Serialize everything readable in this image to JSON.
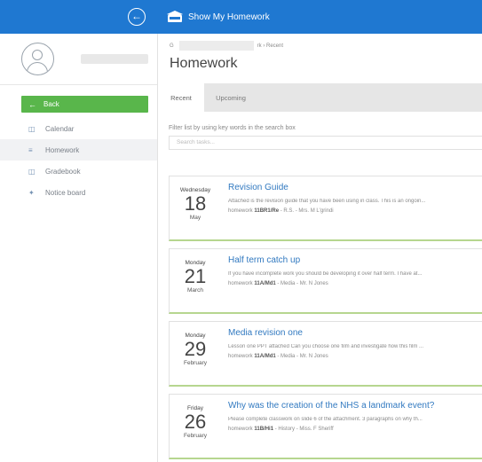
{
  "app": {
    "title": "Show My Homework"
  },
  "sidebar": {
    "back_label": "Back",
    "items": [
      {
        "label": "Calendar",
        "icon": "calendar-icon"
      },
      {
        "label": "Homework",
        "icon": "list-icon"
      },
      {
        "label": "Gradebook",
        "icon": "book-icon"
      },
      {
        "label": "Notice board",
        "icon": "pin-icon"
      }
    ]
  },
  "header": {
    "crumb_prefix": "G",
    "crumb_fragment": "rk",
    "crumb_current": "Recent",
    "title": "Homework"
  },
  "tabs": [
    {
      "label": "Recent"
    },
    {
      "label": "Upcoming"
    }
  ],
  "filter": {
    "label": "Filter list by using key words in the search box",
    "placeholder": "Search tasks..."
  },
  "tasks": [
    {
      "dow": "Wednesday",
      "day": "18",
      "month": "May",
      "title": "Revision Guide",
      "desc": "Attached is the revision guide that you have been using in class. This is an ongoin...",
      "meta_prefix": "homework",
      "class": "11BR1/Re",
      "meta_suffix": "- R.S. - Mrs. M L'grindi"
    },
    {
      "dow": "Monday",
      "day": "21",
      "month": "March",
      "title": "Half term catch up",
      "desc": "If you have incomplete work you should be developing it over half term. I have at...",
      "meta_prefix": "homework",
      "class": "11A/Md1",
      "meta_suffix": "- Media - Mr. N Jones"
    },
    {
      "dow": "Monday",
      "day": "29",
      "month": "February",
      "title": "Media revision one",
      "desc": "Lesson one PPT attached Can you choose one film and investigate how this film ...",
      "meta_prefix": "homework",
      "class": "11A/Md1",
      "meta_suffix": "- Media - Mr. N Jones"
    },
    {
      "dow": "Friday",
      "day": "26",
      "month": "February",
      "title": "Why was the creation of the NHS a landmark event?",
      "desc": "Please complete classwork on slide 6 of the attachment. 3 paragraphs on why th...",
      "meta_prefix": "homework",
      "class": "11B/Hi1",
      "meta_suffix": "- History - Miss. F Sheriff"
    }
  ],
  "colors": {
    "topbar": "#1f78d1",
    "back_button": "#59b64b",
    "link": "#3179c0",
    "card_accent": "#b6d68f"
  }
}
